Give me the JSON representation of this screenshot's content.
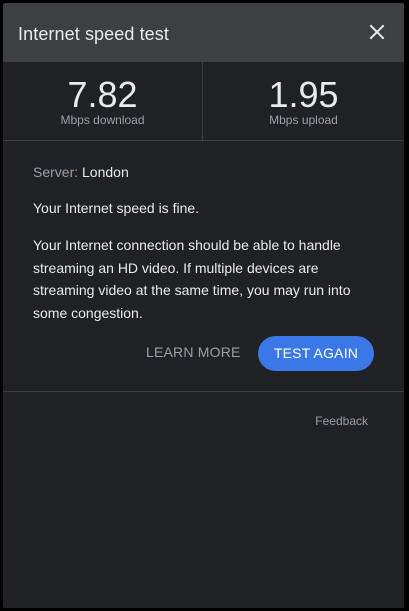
{
  "dialog": {
    "title": "Internet speed test"
  },
  "stats": {
    "download": {
      "value": "7.82",
      "unit": "Mbps download"
    },
    "upload": {
      "value": "1.95",
      "unit": "Mbps upload"
    }
  },
  "result": {
    "server_label": "Server:",
    "server_value": "London",
    "verdict": "Your Internet speed is fine.",
    "description": "Your Internet connection should be able to handle streaming an HD video. If multiple devices are streaming video at the same time, you may run into some congestion."
  },
  "actions": {
    "learn_more_label": "LEARN MORE",
    "test_again_label": "TEST AGAIN"
  },
  "footer": {
    "feedback_label": "Feedback"
  },
  "colors": {
    "background": "#202124",
    "header": "#3c4043",
    "accent": "#3b78e7",
    "text_primary": "#e8eaed",
    "text_secondary": "#9aa0a6"
  },
  "icons": {
    "close": "close-icon"
  }
}
